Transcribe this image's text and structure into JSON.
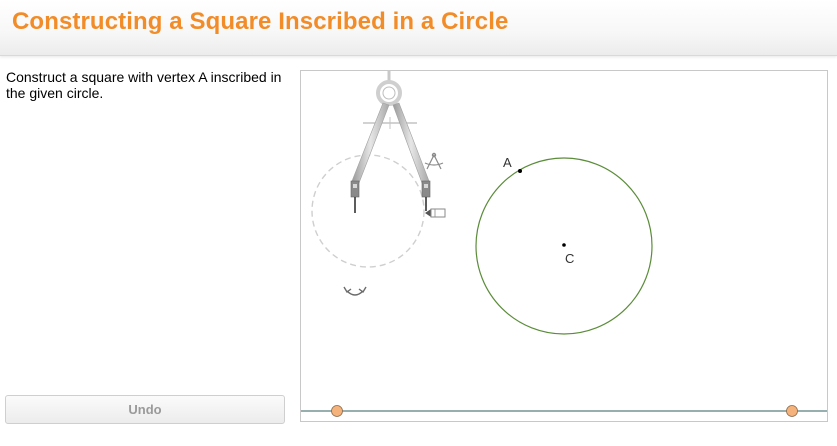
{
  "header": {
    "title": "Constructing a Square Inscribed in a Circle"
  },
  "instructions": {
    "text": "Construct a square with vertex A inscribed in the given circle."
  },
  "toolbar": {
    "undo_label": "Undo"
  },
  "canvas": {
    "points": {
      "a_label": "A",
      "c_label": "C"
    },
    "colors": {
      "circle": "#5b8c3a",
      "slider_track": "#2f5f5f",
      "slider_handle": "#f5b27a",
      "compass": "#b8b8b8"
    },
    "icons": [
      "compass-icon",
      "pencil-icon",
      "rotate-icon",
      "compass-width-icon"
    ]
  }
}
